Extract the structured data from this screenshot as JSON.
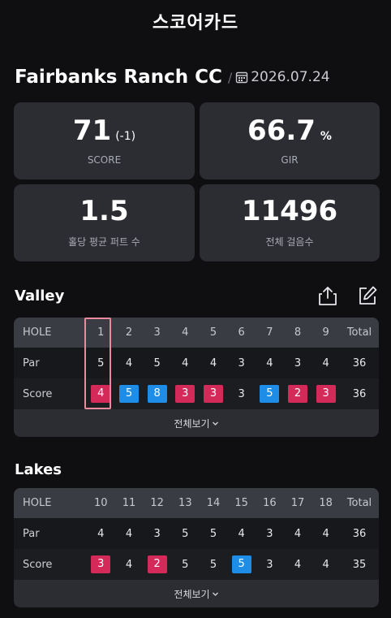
{
  "header": {
    "title": "스코어카드"
  },
  "course": {
    "name": "Fairbanks Ranch CC",
    "slash": "/",
    "date": "2026.07.24"
  },
  "stats": [
    {
      "value": "71",
      "sub": "(-1)",
      "label": "SCORE"
    },
    {
      "value": "66.7",
      "sub": "%",
      "label": "GIR"
    },
    {
      "value": "1.5",
      "sub": "",
      "label": "홀당 평균 퍼트 수"
    },
    {
      "value": "11496",
      "sub": "",
      "label": "전체 걸음수"
    }
  ],
  "sections": [
    {
      "title": "Valley",
      "header": [
        "HOLE",
        "1",
        "2",
        "3",
        "4",
        "5",
        "6",
        "7",
        "8",
        "9",
        "Total"
      ],
      "par": [
        "Par",
        "5",
        "4",
        "5",
        "4",
        "4",
        "3",
        "4",
        "3",
        "4",
        "36"
      ],
      "score": [
        "Score",
        "4",
        "5",
        "8",
        "3",
        "3",
        "3",
        "5",
        "2",
        "3",
        "36"
      ],
      "more": "전체보기"
    },
    {
      "title": "Lakes",
      "header": [
        "HOLE",
        "10",
        "11",
        "12",
        "13",
        "14",
        "15",
        "16",
        "17",
        "18",
        "Total"
      ],
      "par": [
        "Par",
        "4",
        "4",
        "3",
        "5",
        "5",
        "4",
        "3",
        "4",
        "4",
        "36"
      ],
      "score": [
        "Score",
        "3",
        "4",
        "2",
        "5",
        "5",
        "5",
        "3",
        "4",
        "4",
        "35"
      ],
      "more": "전체보기"
    }
  ],
  "colors": {
    "birdie": "#d42a5a",
    "bogey": "#1e8de8",
    "background": "#0f0f12",
    "card": "#2b2d33"
  }
}
